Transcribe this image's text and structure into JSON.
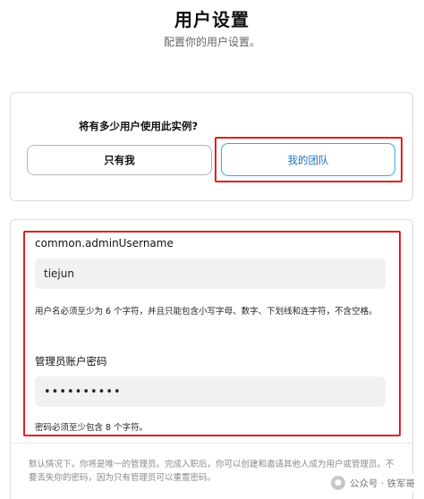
{
  "header": {
    "title": "用户设置",
    "subtitle": "配置你的用户设置。"
  },
  "usage": {
    "question": "将有多少用户使用此实例?",
    "options": [
      {
        "label": "只有我",
        "selected": false
      },
      {
        "label": "我的团队",
        "selected": true
      }
    ]
  },
  "form": {
    "username_label": "common.adminUsername",
    "username_value": "tiejun",
    "username_hint": "用户名必须至少为 6 个字符，并且只能包含小写字母、数字、下划线和连字符，不含空格。",
    "password_label": "管理员账户密码",
    "password_value": "••••••••••",
    "password_hint": "密码必须至少包含 8 个字符。",
    "footnote": "默认情况下，你将是唯一的管理员。完成入职后，你可以创建和邀请其他人成为用户或管理员。不要丢失你的密码，因为只有管理员可以重置密码。"
  },
  "watermark": {
    "text": "公众号 · 铁军哥"
  },
  "colors": {
    "highlight_red": "#e02020",
    "selected_blue": "#3ba3e6",
    "input_bg": "#f1f1f1"
  }
}
